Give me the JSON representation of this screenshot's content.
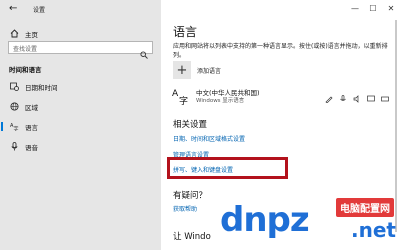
{
  "window": {
    "title": "设置",
    "controls": [
      "—",
      "☐",
      "✕"
    ]
  },
  "sidebar": {
    "home_label": "主页",
    "search_placeholder": "查找设置",
    "section_title": "时间和语言",
    "items": [
      {
        "label": "日期和时间",
        "icon": "calendar-clock-icon"
      },
      {
        "label": "区域",
        "icon": "globe-icon"
      },
      {
        "label": "语言",
        "icon": "language-icon",
        "active": true
      },
      {
        "label": "语音",
        "icon": "microphone-icon"
      }
    ]
  },
  "main": {
    "title": "语言",
    "description": "应用和网站将以列表中支持的第一种语言显示。按住(或按)语言并拖动，以重新排列。",
    "add_language_label": "添加语言",
    "language": {
      "name": "中文(中华人民共和国)",
      "subtitle": "Windows 显示语言"
    },
    "related_title": "相关设置",
    "related_links": [
      "日期、时间和区域格式设置",
      "管理语言设置",
      "拼写、键入和键盘设置"
    ],
    "question_title": "有疑问？",
    "help_link": "获取帮助",
    "bottom_title": "让 Windo"
  },
  "watermark": {
    "text": "dnpz",
    "label": "电脑配置网",
    "suffix": ".net"
  },
  "colors": {
    "accent": "#0078d7",
    "link": "#0063b1",
    "highlight_box": "#b3121c",
    "sidebar_bg": "#e6e6e6"
  }
}
